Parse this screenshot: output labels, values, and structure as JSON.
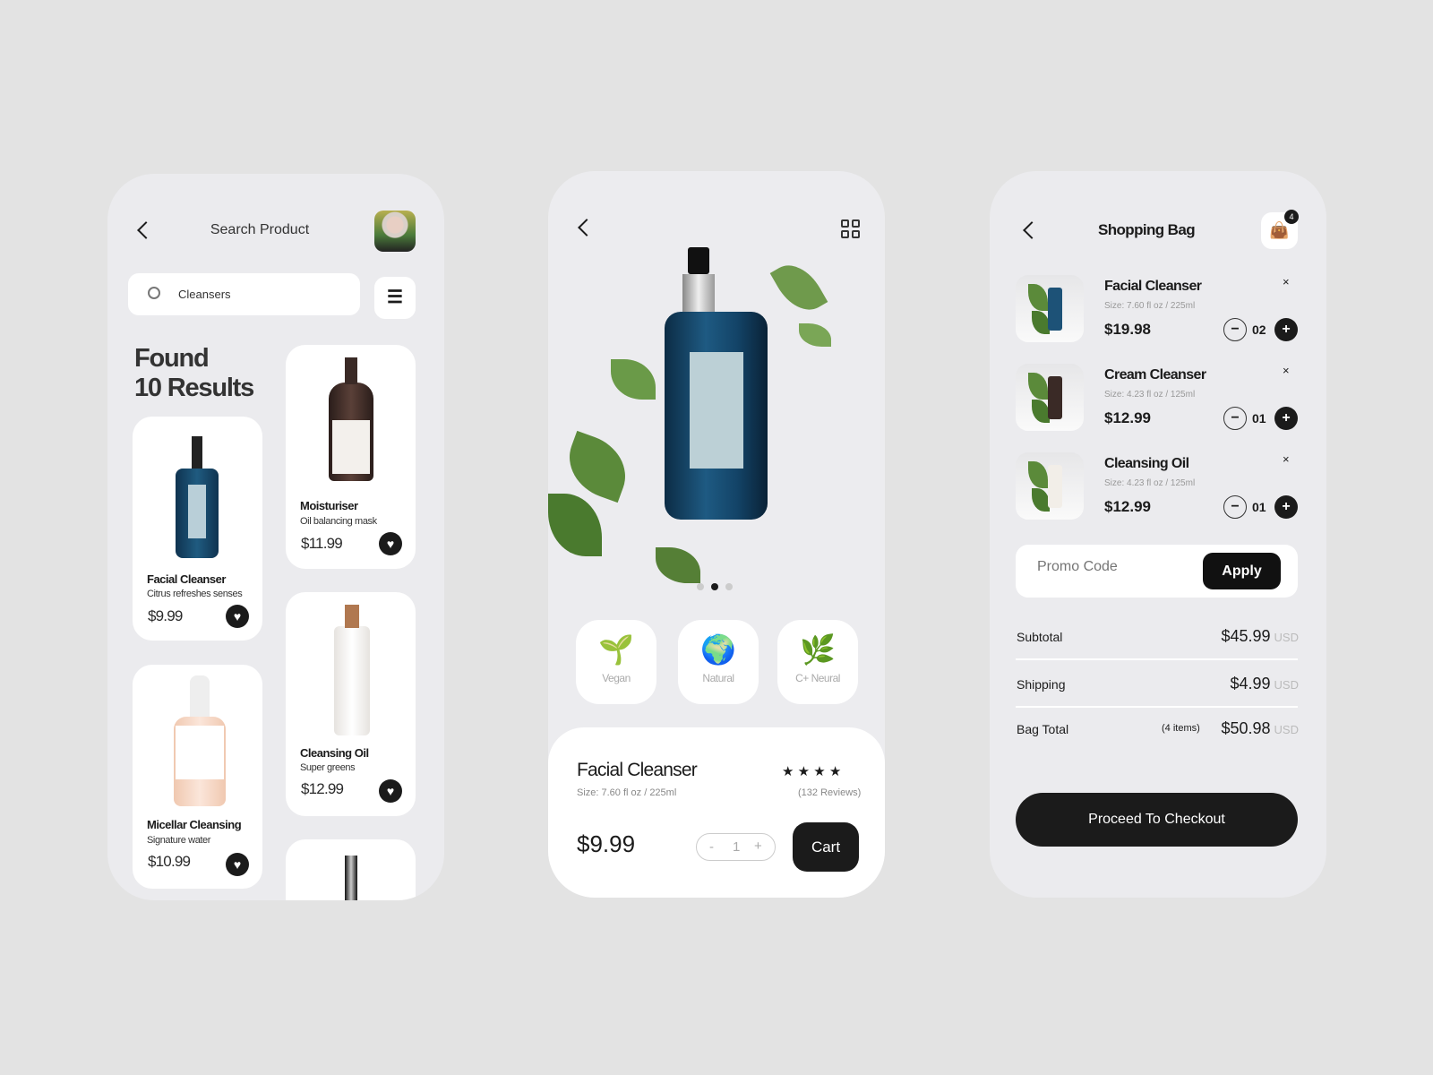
{
  "search_screen": {
    "title": "Search Product",
    "search": {
      "value": "Cleansers"
    },
    "found_line1": "Found",
    "found_line2": "10  Results",
    "products": [
      {
        "name": "Facial Cleanser",
        "subtitle": "Citrus refreshes senses",
        "price": "$9.99"
      },
      {
        "name": "Moisturiser",
        "subtitle": "Oil balancing mask",
        "price": "$11.99"
      },
      {
        "name": "Micellar Cleansing",
        "subtitle": "Signature water",
        "price": "$10.99"
      },
      {
        "name": "Cleansing Oil",
        "subtitle": "Super greens",
        "price": "$12.99"
      }
    ]
  },
  "detail_screen": {
    "features": [
      {
        "label": "Vegan",
        "icon": "sprout-icon"
      },
      {
        "label": "Natural",
        "icon": "earth-lotus-icon"
      },
      {
        "label": "C+ Neural",
        "icon": "hand-plant-icon"
      }
    ],
    "carousel": {
      "count": 3,
      "active": 2
    },
    "product": {
      "name": "Facial Cleanser",
      "size": "Size: 7.60 fl oz / 225ml",
      "stars": "★ ★ ★ ★",
      "rating": 4,
      "reviews": "(132 Reviews)",
      "price": "$9.99",
      "quantity": "1",
      "minus": "-",
      "plus": "+",
      "cart_label": "Cart"
    }
  },
  "bag_screen": {
    "title": "Shopping Bag",
    "badge_count": "4",
    "items": [
      {
        "name": "Facial Cleanser",
        "size": "Size: 7.60 fl oz / 225ml",
        "price": "$19.98",
        "qty": "02"
      },
      {
        "name": "Cream Cleanser",
        "size": "Size: 4.23 fl oz / 125ml",
        "price": "$12.99",
        "qty": "01"
      },
      {
        "name": "Cleansing Oil",
        "size": "Size: 4.23 fl oz / 125ml",
        "price": "$12.99",
        "qty": "01"
      }
    ],
    "promo_placeholder": "Promo Code",
    "apply_label": "Apply",
    "subtotal": {
      "label": "Subtotal",
      "value": "$45.99",
      "currency": "USD"
    },
    "shipping": {
      "label": "Shipping",
      "value": "$4.99",
      "currency": "USD"
    },
    "total": {
      "label": "Bag Total",
      "items": "(4 items)",
      "value": "$50.98",
      "currency": "USD"
    },
    "checkout_label": "Proceed To Checkout"
  }
}
